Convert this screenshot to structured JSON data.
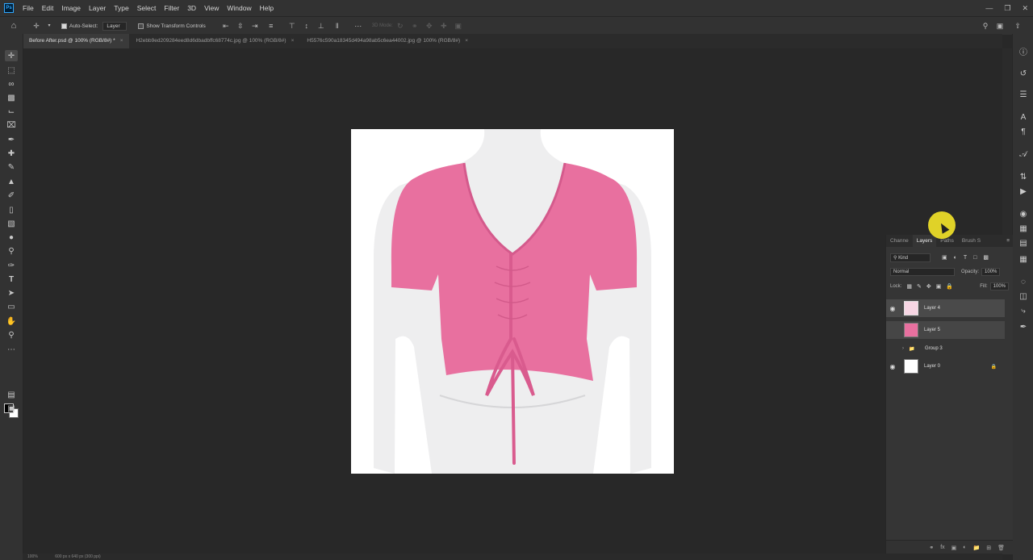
{
  "menubar": {
    "logo": "Ps",
    "items": [
      "File",
      "Edit",
      "Image",
      "Layer",
      "Type",
      "Select",
      "Filter",
      "3D",
      "View",
      "Window",
      "Help"
    ]
  },
  "options": {
    "auto_select_label": "Auto-Select:",
    "auto_select_value": "Layer",
    "transform_label": "Show Transform Controls",
    "mode_3d": "3D Mode:"
  },
  "tabs": [
    {
      "label": "Before After.psd @ 100% (RGB/8#) *"
    },
    {
      "label": "H2ebb9ed209284eed8d6dbadbffc68774c.jpg @ 100% (RGB/8#)"
    },
    {
      "label": "H5576c590a18345d494a98ab5c6ea44002.jpg @ 100% (RGB/8#)"
    }
  ],
  "layers_panel": {
    "tabs": [
      "Channe",
      "Layers",
      "Paths",
      "Brush S"
    ],
    "filter_label": "Kind",
    "blend_mode": "Normal",
    "opacity_label": "Opacity:",
    "opacity_value": "100%",
    "lock_label": "Lock:",
    "fill_label": "Fill:",
    "fill_value": "100%",
    "layers": [
      {
        "name": "Layer 4",
        "visible": true
      },
      {
        "name": "Layer 5",
        "visible": false
      },
      {
        "name": "Group 3",
        "visible": false
      },
      {
        "name": "Layer 0",
        "visible": true
      }
    ]
  },
  "status": {
    "zoom": "100%",
    "doc_size": "600 px x 640 px (300 ppi)"
  },
  "colors": {
    "shirt": "#e8709f",
    "canvas_bg": "#282828"
  }
}
